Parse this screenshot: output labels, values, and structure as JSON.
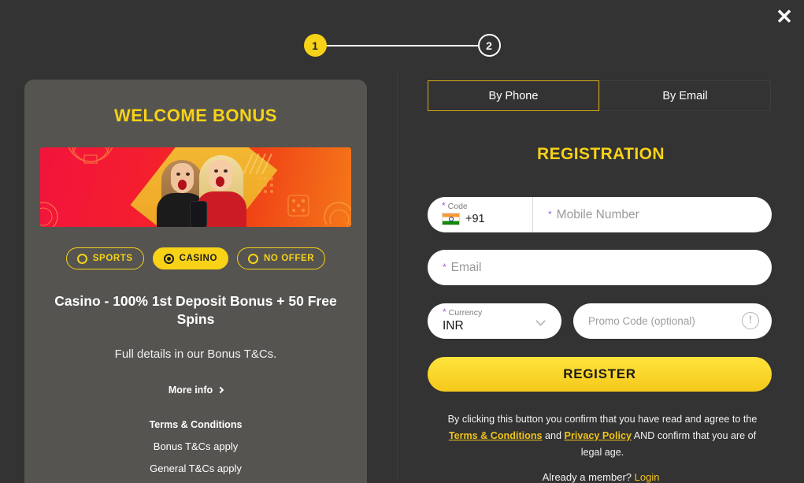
{
  "window": {
    "close_label": "✕"
  },
  "stepper": {
    "steps": [
      {
        "number": "1",
        "state": "active"
      },
      {
        "number": "2",
        "state": "inactive"
      }
    ]
  },
  "promo": {
    "title": "WELCOME BONUS",
    "banner_alt": "two women celebrating with phone",
    "offers": [
      {
        "label": "SPORTS",
        "selected": false
      },
      {
        "label": "CASINO",
        "selected": true
      },
      {
        "label": "NO OFFER",
        "selected": false
      }
    ],
    "bonus_headline": "Casino - 100% 1st Deposit Bonus + 50 Free Spins",
    "bonus_subtext": "Full details in our Bonus T&Cs.",
    "more_info_label": "More info",
    "terms_title": "Terms & Conditions",
    "terms_links": [
      "Bonus T&Cs apply",
      "General T&Cs apply"
    ]
  },
  "registration": {
    "tabs": [
      {
        "label": "By Phone",
        "active": true
      },
      {
        "label": "By Email",
        "active": false
      }
    ],
    "title": "REGISTRATION",
    "fields": {
      "code_label": "Code",
      "code_value": "+91",
      "code_flag": "india-flag",
      "mobile_placeholder": "Mobile Number",
      "email_placeholder": "Email",
      "currency_label": "Currency",
      "currency_value": "INR",
      "promo_placeholder": "Promo Code (optional)"
    },
    "submit_label": "REGISTER",
    "disclaimer": {
      "part1": "By clicking this button you confirm that you have read and agree to the ",
      "terms_link": "Terms & Conditions",
      "conjunction": " and ",
      "privacy_link": "Privacy Policy",
      "part2": " AND confirm that you are of legal age."
    },
    "login_prompt": "Already a member? ",
    "login_link": "Login"
  },
  "colors": {
    "page_bg": "#333333",
    "panel_bg": "#555450",
    "accent_yellow": "#f7d217",
    "link_yellow": "#f0c419",
    "text_white": "#ffffff",
    "field_bg": "#ffffff",
    "required_star": "#9b5de0"
  }
}
